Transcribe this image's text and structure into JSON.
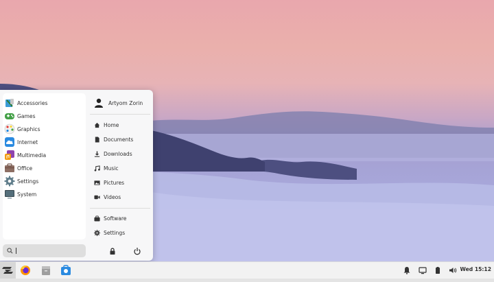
{
  "menu": {
    "categories": [
      {
        "label": "Accessories",
        "icon": "accessories-icon"
      },
      {
        "label": "Games",
        "icon": "games-icon"
      },
      {
        "label": "Graphics",
        "icon": "graphics-icon"
      },
      {
        "label": "Internet",
        "icon": "internet-icon"
      },
      {
        "label": "Multimedia",
        "icon": "multimedia-icon"
      },
      {
        "label": "Office",
        "icon": "office-icon"
      },
      {
        "label": "Settings",
        "icon": "settings-icon"
      },
      {
        "label": "System",
        "icon": "system-icon"
      }
    ],
    "search": {
      "placeholder": "",
      "value": ""
    },
    "user": {
      "name": "Artyom Zorin"
    },
    "places": [
      {
        "label": "Home",
        "icon": "home-icon"
      },
      {
        "label": "Documents",
        "icon": "documents-icon"
      },
      {
        "label": "Downloads",
        "icon": "downloads-icon"
      },
      {
        "label": "Music",
        "icon": "music-icon"
      },
      {
        "label": "Pictures",
        "icon": "pictures-icon"
      },
      {
        "label": "Videos",
        "icon": "videos-icon"
      }
    ],
    "system_links": [
      {
        "label": "Software",
        "icon": "software-icon"
      },
      {
        "label": "Settings",
        "icon": "settings-gear-icon"
      }
    ],
    "power_buttons": [
      "lock-icon",
      "power-icon"
    ]
  },
  "taskbar": {
    "launchers": [
      "zorin-menu-icon",
      "firefox-icon",
      "files-icon",
      "software-store-icon"
    ],
    "tray": [
      "notifications-icon",
      "display-icon",
      "battery-icon",
      "volume-icon"
    ],
    "clock": "Wed 15:12"
  },
  "colors": {
    "sky_top": "#e9a7ad",
    "mist": "#a7a6d9",
    "menu_bg": "#f7f7f8",
    "taskbar_bg": "#f2f2f2",
    "accent_blue": "#2a8ae0"
  }
}
